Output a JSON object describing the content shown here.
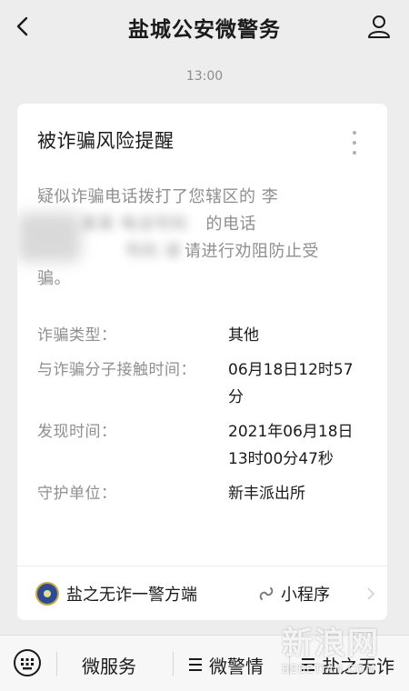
{
  "header": {
    "title": "盐城公安微警务",
    "back_icon": "chevron-left-icon",
    "profile_icon": "person-icon"
  },
  "timestamp": "13:00",
  "card": {
    "title": "被诈骗风险提醒",
    "body": {
      "line1": "疑似诈骗电话拨打了您辖区的 李",
      "line2_blurred": "某某 电话号码",
      "line2_visible": "的电话",
      "line3_blurred": "号码 请",
      "line3_visible": "请进行劝阻防止受",
      "line4": "骗。"
    },
    "fields": [
      {
        "label": "诈骗类型：",
        "value": "其他"
      },
      {
        "label": "与诈骗分子接触时间：",
        "value": "06月18日12时57分"
      },
      {
        "label": "发现时间：",
        "value": "2021年06月18日13时00分47秒"
      },
      {
        "label": "守护单位：",
        "value": "新丰派出所"
      }
    ],
    "footer": {
      "mini_program_name": "盐之无诈一警方端",
      "mini_program_label": "小程序"
    }
  },
  "bottom_bar": {
    "items": [
      {
        "label": "微服务"
      },
      {
        "label": "微警情"
      },
      {
        "label": "盐之无诈"
      }
    ]
  },
  "watermark": {
    "text": "新浪网",
    "sub": "BEBETIAN.COM"
  },
  "colors": {
    "background": "#ededed",
    "card": "#ffffff",
    "muted_text": "#8f8f8f",
    "text": "#1a1a1a",
    "logo_blue": "#2b4c8e"
  }
}
